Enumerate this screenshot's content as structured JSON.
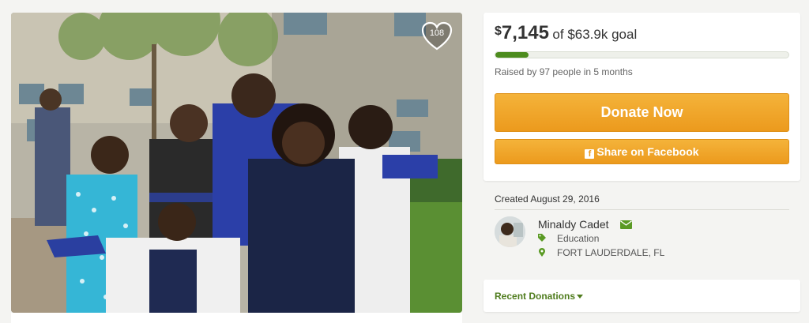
{
  "campaign": {
    "photo_alt": "",
    "hearts": "108",
    "amount_currency": "$",
    "amount_raised": "7,145",
    "goal_text": "of $63.9k goal",
    "progress_fraction": 0.112,
    "raised_by": "Raised by 97 people in 5 months",
    "donate_label": "Donate Now",
    "share_label": "Share on Facebook",
    "share_icon_glyph": "f"
  },
  "meta": {
    "created": "Created August 29, 2016"
  },
  "organizer": {
    "name": "Minaldy Cadet",
    "category": "Education",
    "location": "FORT LAUDERDALE, FL"
  },
  "recent": {
    "label": "Recent Donations"
  },
  "colors": {
    "accent_green": "#4d8c1e",
    "donate_orange": "#ec9a1d",
    "link_green": "#4f7c1d"
  },
  "icons": {
    "heart": "heart-icon",
    "facebook": "facebook-icon",
    "mail": "mail-icon",
    "category": "tag-icon",
    "location": "map-pin-icon",
    "caret": "caret-down-icon"
  }
}
